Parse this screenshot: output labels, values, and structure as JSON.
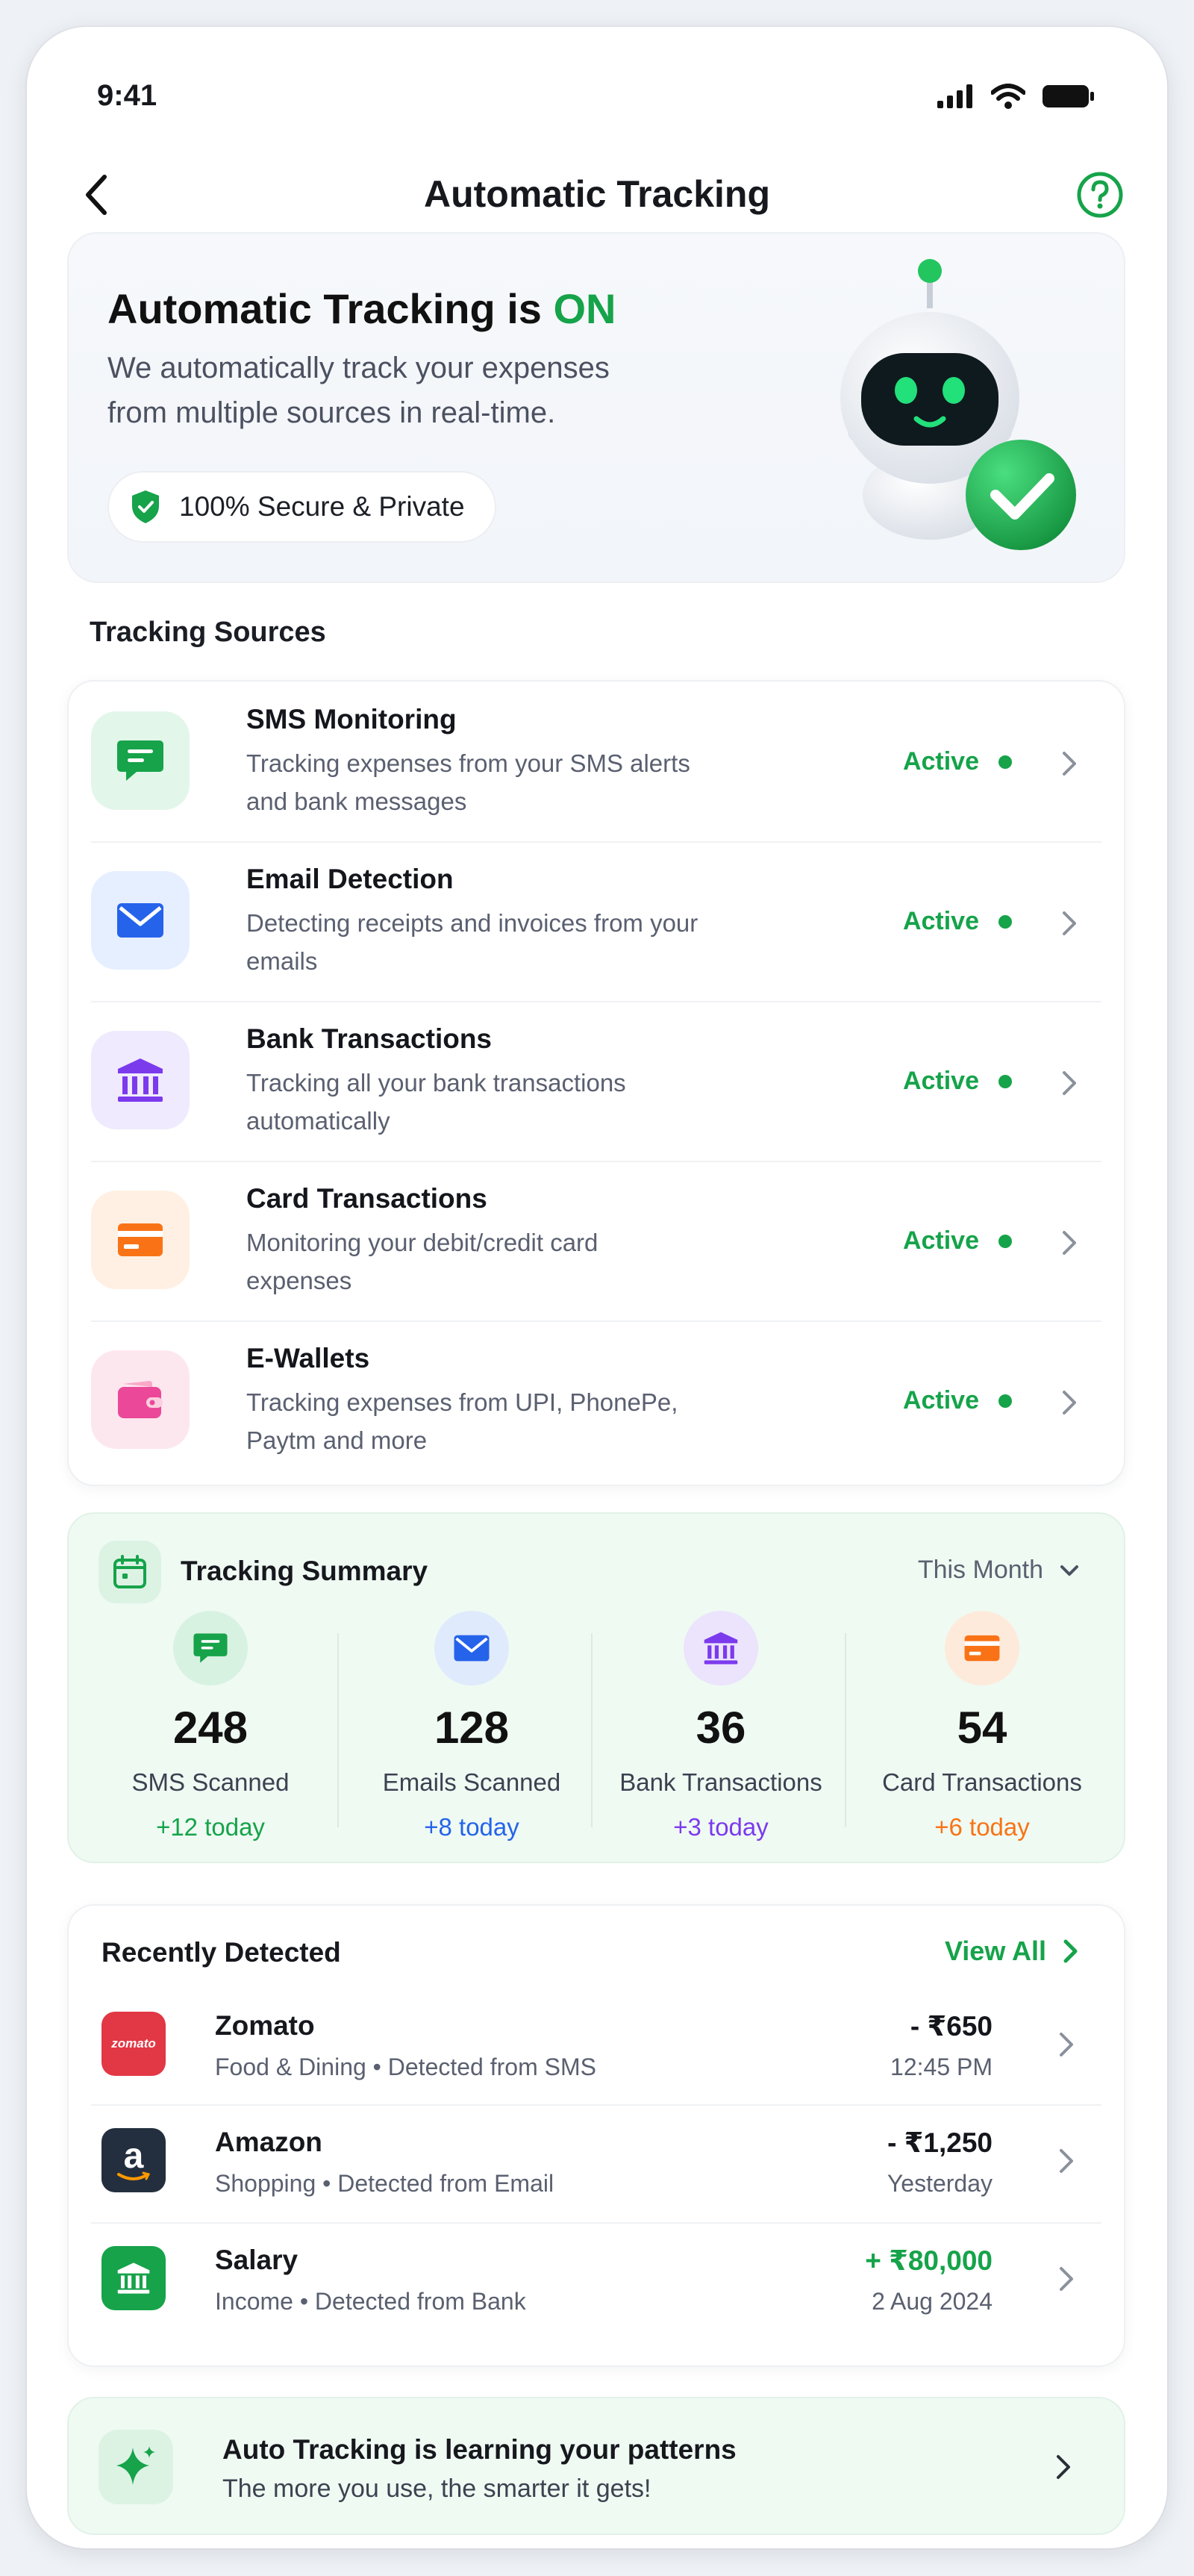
{
  "status_bar": {
    "time": "9:41"
  },
  "nav": {
    "title": "Automatic Tracking"
  },
  "hero": {
    "title_prefix": "Automatic Tracking is ",
    "title_state": "ON",
    "description": "We automatically track your expenses from multiple sources in real-time.",
    "secure_label": "100% Secure & Private"
  },
  "sources": {
    "heading": "Tracking Sources",
    "items": [
      {
        "title": "SMS Monitoring",
        "description": "Tracking expenses from your SMS alerts and bank messages",
        "status": "Active",
        "icon": "message-icon"
      },
      {
        "title": "Email Detection",
        "description": "Detecting receipts and invoices from your emails",
        "status": "Active",
        "icon": "mail-icon"
      },
      {
        "title": "Bank Transactions",
        "description": "Tracking all your bank transactions automatically",
        "status": "Active",
        "icon": "bank-icon"
      },
      {
        "title": "Card Transactions",
        "description": "Monitoring your debit/credit card expenses",
        "status": "Active",
        "icon": "card-icon"
      },
      {
        "title": "E-Wallets",
        "description": "Tracking expenses from UPI, PhonePe, Paytm and more",
        "status": "Active",
        "icon": "wallet-icon"
      }
    ]
  },
  "summary": {
    "title": "Tracking Summary",
    "period": "This Month",
    "stats": [
      {
        "value": "248",
        "label": "SMS Scanned",
        "today": "+12 today",
        "color": "#16a34a"
      },
      {
        "value": "128",
        "label": "Emails Scanned",
        "today": "+8 today",
        "color": "#2563eb"
      },
      {
        "value": "36",
        "label": "Bank Transactions",
        "today": "+3 today",
        "color": "#7c3aed"
      },
      {
        "value": "54",
        "label": "Card Transactions",
        "today": "+6 today",
        "color": "#f97316"
      }
    ]
  },
  "recent": {
    "title": "Recently Detected",
    "view_all": "View All",
    "items": [
      {
        "name": "Zomato",
        "meta": "Food & Dining • Detected from SMS",
        "amount": "- ₹650",
        "time": "12:45 PM",
        "logo_text": "zomato"
      },
      {
        "name": "Amazon",
        "meta": "Shopping • Detected from Email",
        "amount": "- ₹1,250",
        "time": "Yesterday",
        "logo_text": "a"
      },
      {
        "name": "Salary",
        "meta": "Income • Detected from Bank",
        "amount": "+ ₹80,000",
        "time": "2 Aug 2024"
      }
    ]
  },
  "learning": {
    "title": "Auto Tracking is learning your patterns",
    "subtitle": "The more you use, the smarter it gets!"
  },
  "colors": {
    "accent": "#16a34a",
    "email": "#2563eb",
    "bank": "#7c3aed",
    "card": "#f97316",
    "wallet": "#ec4899"
  }
}
